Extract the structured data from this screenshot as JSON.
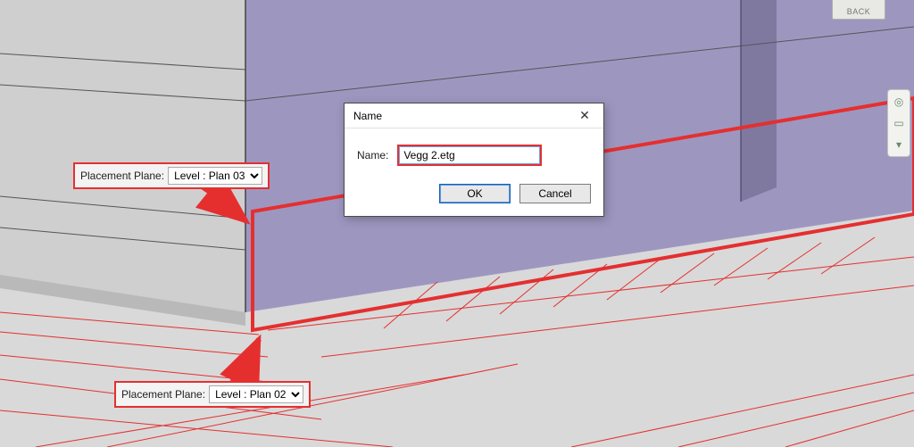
{
  "callouts": {
    "top": {
      "label": "Placement Plane:",
      "value": "Level : Plan 03"
    },
    "bottom": {
      "label": "Placement Plane:",
      "value": "Level : Plan 02"
    }
  },
  "dialog": {
    "title": "Name",
    "field_label": "Name:",
    "field_value": "Vegg 2.etg",
    "ok": "OK",
    "cancel": "Cancel"
  },
  "nav": {
    "back_label": "BACK"
  }
}
